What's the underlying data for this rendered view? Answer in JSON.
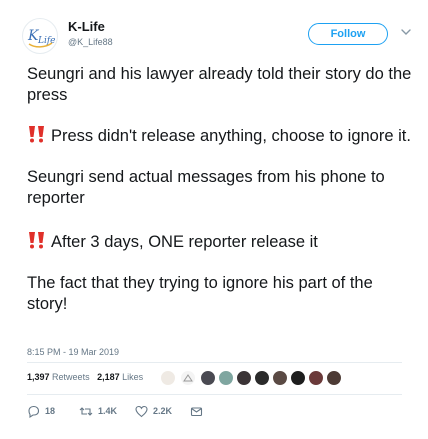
{
  "user": {
    "name": "K-Life",
    "handle": "@K_Life88"
  },
  "header": {
    "follow_label": "Follow"
  },
  "tweet": {
    "paragraphs": [
      "Seungri and his lawyer already told their story do the press",
      "Press didn't release anything, choose to ignore it.",
      "Seungri send actual messages from his phone to reporter",
      "After 3 days, ONE reporter release it",
      "The fact that they trying to ignore his part of the story!"
    ],
    "timestamp": "8:15 PM - 19 Mar 2019"
  },
  "stats": {
    "retweets_count": "1,397",
    "retweets_label": "Retweets",
    "likes_count": "2,187",
    "likes_label": "Likes"
  },
  "actions": {
    "reply_count": "18",
    "retweet_count": "1.4K",
    "like_count": "2.2K"
  },
  "colors": {
    "accent": "#1da1f2",
    "text": "#14171a",
    "muted": "#657786",
    "emoji_red": "#e0302a"
  },
  "icons": {
    "caret": "chevron-down-icon",
    "reply": "reply-icon",
    "retweet": "retweet-icon",
    "like": "heart-icon",
    "message": "envelope-icon",
    "exclamation": "double-exclamation-icon"
  }
}
